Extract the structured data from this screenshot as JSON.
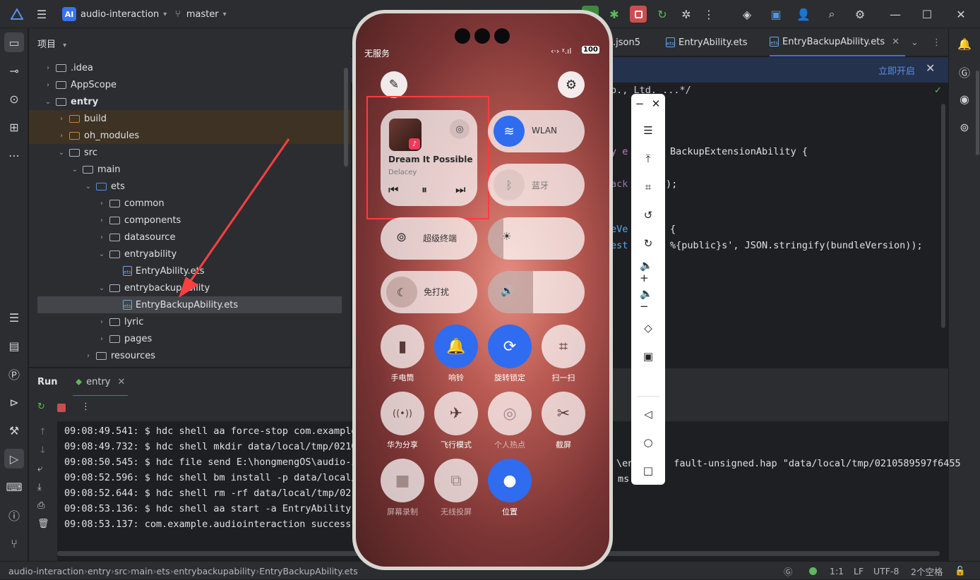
{
  "titlebar": {
    "app_badge": "AI",
    "project_name": "audio-interaction",
    "branch": "master"
  },
  "project_panel": {
    "title": "项目",
    "tree": [
      {
        "label": ".idea",
        "depth": 1,
        "expanded": false,
        "kind": "folder"
      },
      {
        "label": "AppScope",
        "depth": 1,
        "expanded": false,
        "kind": "folder"
      },
      {
        "label": "entry",
        "depth": 1,
        "expanded": true,
        "kind": "module"
      },
      {
        "label": "build",
        "depth": 2,
        "expanded": false,
        "kind": "folder-excluded"
      },
      {
        "label": "oh_modules",
        "depth": 2,
        "expanded": false,
        "kind": "folder-excluded"
      },
      {
        "label": "src",
        "depth": 2,
        "expanded": true,
        "kind": "folder"
      },
      {
        "label": "main",
        "depth": 3,
        "expanded": true,
        "kind": "folder"
      },
      {
        "label": "ets",
        "depth": 4,
        "expanded": true,
        "kind": "folder-source"
      },
      {
        "label": "common",
        "depth": 5,
        "expanded": false,
        "kind": "folder"
      },
      {
        "label": "components",
        "depth": 5,
        "expanded": false,
        "kind": "folder"
      },
      {
        "label": "datasource",
        "depth": 5,
        "expanded": false,
        "kind": "folder"
      },
      {
        "label": "entryability",
        "depth": 5,
        "expanded": true,
        "kind": "folder"
      },
      {
        "label": "EntryAbility.ets",
        "depth": 6,
        "kind": "file"
      },
      {
        "label": "entrybackupability",
        "depth": 5,
        "expanded": true,
        "kind": "folder"
      },
      {
        "label": "EntryBackupAbility.ets",
        "depth": 6,
        "kind": "file",
        "selected": true
      },
      {
        "label": "lyric",
        "depth": 5,
        "expanded": false,
        "kind": "folder"
      },
      {
        "label": "pages",
        "depth": 5,
        "expanded": false,
        "kind": "folder"
      },
      {
        "label": "resources",
        "depth": 4,
        "expanded": false,
        "kind": "folder"
      }
    ]
  },
  "editor": {
    "tabs": [
      {
        "label": ".json5",
        "active": false
      },
      {
        "label": "EntryAbility.ets",
        "active": false
      },
      {
        "label": "EntryBackupAbility.ets",
        "active": true
      }
    ],
    "banner_action": "立即开启",
    "code_lines": [
      {
        "text": "o., Ltd. ...*/",
        "color": "#7a7e85"
      },
      {
        "text": "y e",
        "color": "#c77dbb"
      },
      {
        "text": "BackupExtensionAbility {",
        "color": "#6aab73"
      },
      {
        "text": "ack",
        "color": "#9876aa"
      },
      {
        "text": ");",
        "color": "#dfe1e5"
      },
      {
        "text": "eVe",
        "color": "#56a8f5"
      },
      {
        "text": "{",
        "color": "#dfe1e5"
      },
      {
        "text": "est",
        "color": "#56a8f5"
      },
      {
        "text": "%{public}s', JSON.stringify(bundleVersion));",
        "color": "#dfe1e5"
      }
    ]
  },
  "run": {
    "tab_title": "Run",
    "config_name": "entry",
    "console_lines": [
      "09:08:49.541: $ hdc shell aa force-stop com.example",
      "09:08:49.732: $ hdc shell mkdir data/local/tmp/0210",
      "09:08:50.545: $ hdc file send E:\\hongmengOS\\audio-i",
      "09:08:52.596: $ hdc shell bm install -p data/local/",
      "09:08:52.644: $ hdc shell rm -rf data/local/tmp/021",
      "09:08:53.136: $ hdc shell aa start -a EntryAbility",
      "09:08:53.137: com.example.audiointeraction successf"
    ],
    "console_tail_line3": "\\ent      fault-unsigned.hap \"data/local/tmp/0210589597f6455",
    "console_tail_line4": "ms"
  },
  "statusbar": {
    "breadcrumb": [
      "audio-interaction",
      "entry",
      "src",
      "main",
      "ets",
      "entrybackupability",
      "EntryBackupAbility.ets"
    ],
    "position": "1:1",
    "line_sep": "LF",
    "encoding": "UTF-8",
    "indent": "2个空格"
  },
  "phone": {
    "carrier": "无服务",
    "battery": "100",
    "media": {
      "title": "Dream It Possible",
      "artist": "Delacey"
    },
    "wlan_label": "WLAN",
    "bluetooth_label": "蓝牙",
    "super_terminal_label": "超级终端",
    "dnd_label": "免打扰",
    "toggles": [
      {
        "label": "手电筒",
        "on": false,
        "icon": "flashlight-icon",
        "glyph": "▮"
      },
      {
        "label": "响铃",
        "on": true,
        "icon": "bell-icon",
        "glyph": "🔔"
      },
      {
        "label": "旋转锁定",
        "on": true,
        "icon": "rotation-lock-icon",
        "glyph": "⟳"
      },
      {
        "label": "扫一扫",
        "on": false,
        "icon": "scan-icon",
        "glyph": "⌗"
      },
      {
        "label": "华为分享",
        "on": false,
        "icon": "share-icon",
        "glyph": "((•))"
      },
      {
        "label": "飞行模式",
        "on": false,
        "icon": "airplane-icon",
        "glyph": "✈"
      },
      {
        "label": "个人热点",
        "on": false,
        "dim": true,
        "icon": "hotspot-icon",
        "glyph": "◎"
      },
      {
        "label": "截屏",
        "on": false,
        "icon": "screenshot-icon",
        "glyph": "✂"
      },
      {
        "label": "屏幕录制",
        "on": false,
        "dim": true,
        "icon": "screen-record-icon",
        "glyph": "■"
      },
      {
        "label": "无线投屏",
        "on": false,
        "dim": true,
        "icon": "cast-icon",
        "glyph": "⧉"
      },
      {
        "label": "位置",
        "on": true,
        "icon": "location-icon",
        "glyph": "●"
      }
    ]
  },
  "colors": {
    "accent": "#3574f0",
    "highlight_box": "#ff3b3b",
    "arrow": "#ff4040",
    "phone_toggle_on": "#2f6cf0"
  }
}
